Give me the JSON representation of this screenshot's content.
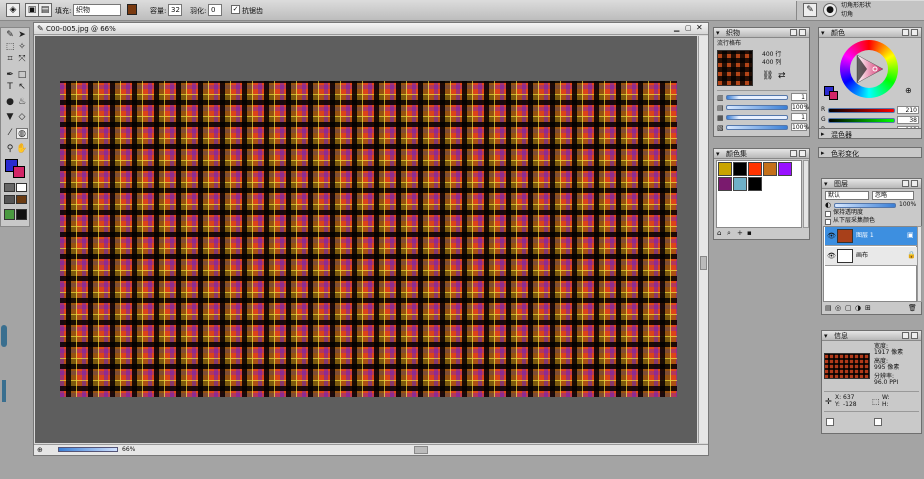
{
  "toolbar": {
    "fill_label": "填充:",
    "fill_value": "织物",
    "opacity_label": "容量:",
    "opacity_value": "32",
    "tolerance_label": "羽化:",
    "tolerance_value": "0",
    "antialias_label": "抗锯齿",
    "antialias_checked": true,
    "preset_top": "切角形形状",
    "preset_bottom": "切角"
  },
  "document": {
    "title": "C00-005.jpg @ 66%",
    "zoom": "66%"
  },
  "fabric_panel": {
    "title": "织物",
    "pattern_name": "流行格布",
    "rows": "400 行",
    "cols": "400 列",
    "slider_values": [
      "1",
      "100%",
      "1",
      "100%"
    ]
  },
  "swatch_panel": {
    "title": "颜色集",
    "colors": [
      "#c9a400",
      "#000000",
      "#ff3300",
      "#c4701a",
      "#9911ff",
      "#7a1a6e",
      "#6fb0c8",
      "#000000"
    ]
  },
  "color_panel": {
    "title": "颜色",
    "r_label": "R",
    "r_value": "210",
    "g_label": "G",
    "g_value": "38",
    "b_label": "B",
    "b_value": "103",
    "mixer_label": "混色器",
    "variation_label": "色彩变化",
    "primary_color": "#2a2ad0",
    "secondary_color": "#d22667"
  },
  "layers_panel": {
    "title": "图层",
    "blend_mode": "默认",
    "composite": "忽略",
    "opacity": "100%",
    "preserve_transparency": "保持透明度",
    "pick_up_color": "从下层采集颜色",
    "layers": [
      {
        "name": "图层 1",
        "selected": true
      },
      {
        "name": "画布",
        "selected": false
      }
    ]
  },
  "info_panel": {
    "title": "信息",
    "width_label": "宽度:",
    "width_value": "1917 像素",
    "height_label": "高度:",
    "height_value": "995 像素",
    "resolution_label": "分辨率:",
    "resolution_value": "96.0 PPI",
    "x_label": "X:",
    "x_value": "637",
    "y_label": "Y:",
    "y_value": "-128",
    "w_label": "W:",
    "w_value": "",
    "h_label": "H:",
    "h_value": ""
  }
}
